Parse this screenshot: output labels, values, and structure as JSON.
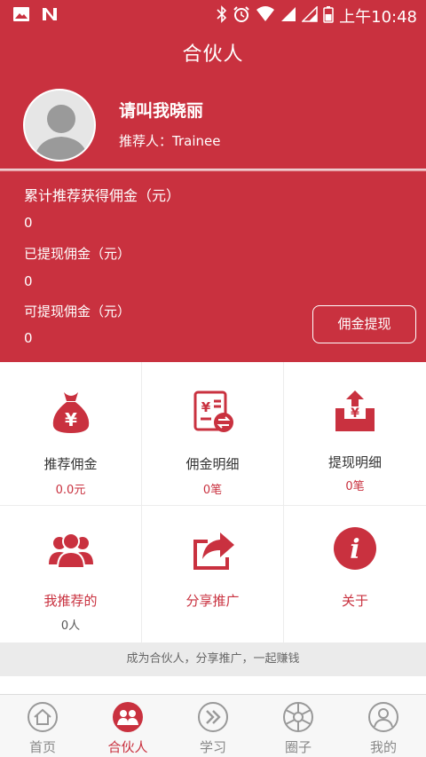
{
  "status_bar": {
    "time": "上午10:48"
  },
  "header": {
    "title": "合伙人"
  },
  "profile": {
    "name": "请叫我晓丽",
    "referrer": "推荐人：Trainee"
  },
  "earnings": {
    "total_label": "累计推荐获得佣金（元）",
    "total_value": "0",
    "withdrawn_label": "已提现佣金（元）",
    "withdrawn_value": "0",
    "available_label": "可提现佣金（元）",
    "available_value": "0",
    "withdraw_button": "佣金提现"
  },
  "grid": {
    "commission": {
      "label": "推荐佣金",
      "value": "0.0元"
    },
    "commission_detail": {
      "label": "佣金明细",
      "value": "0笔"
    },
    "withdraw_detail": {
      "label": "提现明细",
      "value": "0笔"
    },
    "my_referrals": {
      "label": "我推荐的",
      "value": "0人"
    },
    "share": {
      "label": "分享推广"
    },
    "about": {
      "label": "关于"
    }
  },
  "slogan": "成为合伙人，分享推广，一起赚钱",
  "tabs": [
    {
      "label": "首页",
      "icon": "home-icon"
    },
    {
      "label": "合伙人",
      "icon": "partner-icon"
    },
    {
      "label": "学习",
      "icon": "learn-icon"
    },
    {
      "label": "圈子",
      "icon": "circle-icon"
    },
    {
      "label": "我的",
      "icon": "user-icon"
    }
  ],
  "colors": {
    "accent": "#c9313f",
    "tab_inactive": "#888888"
  }
}
